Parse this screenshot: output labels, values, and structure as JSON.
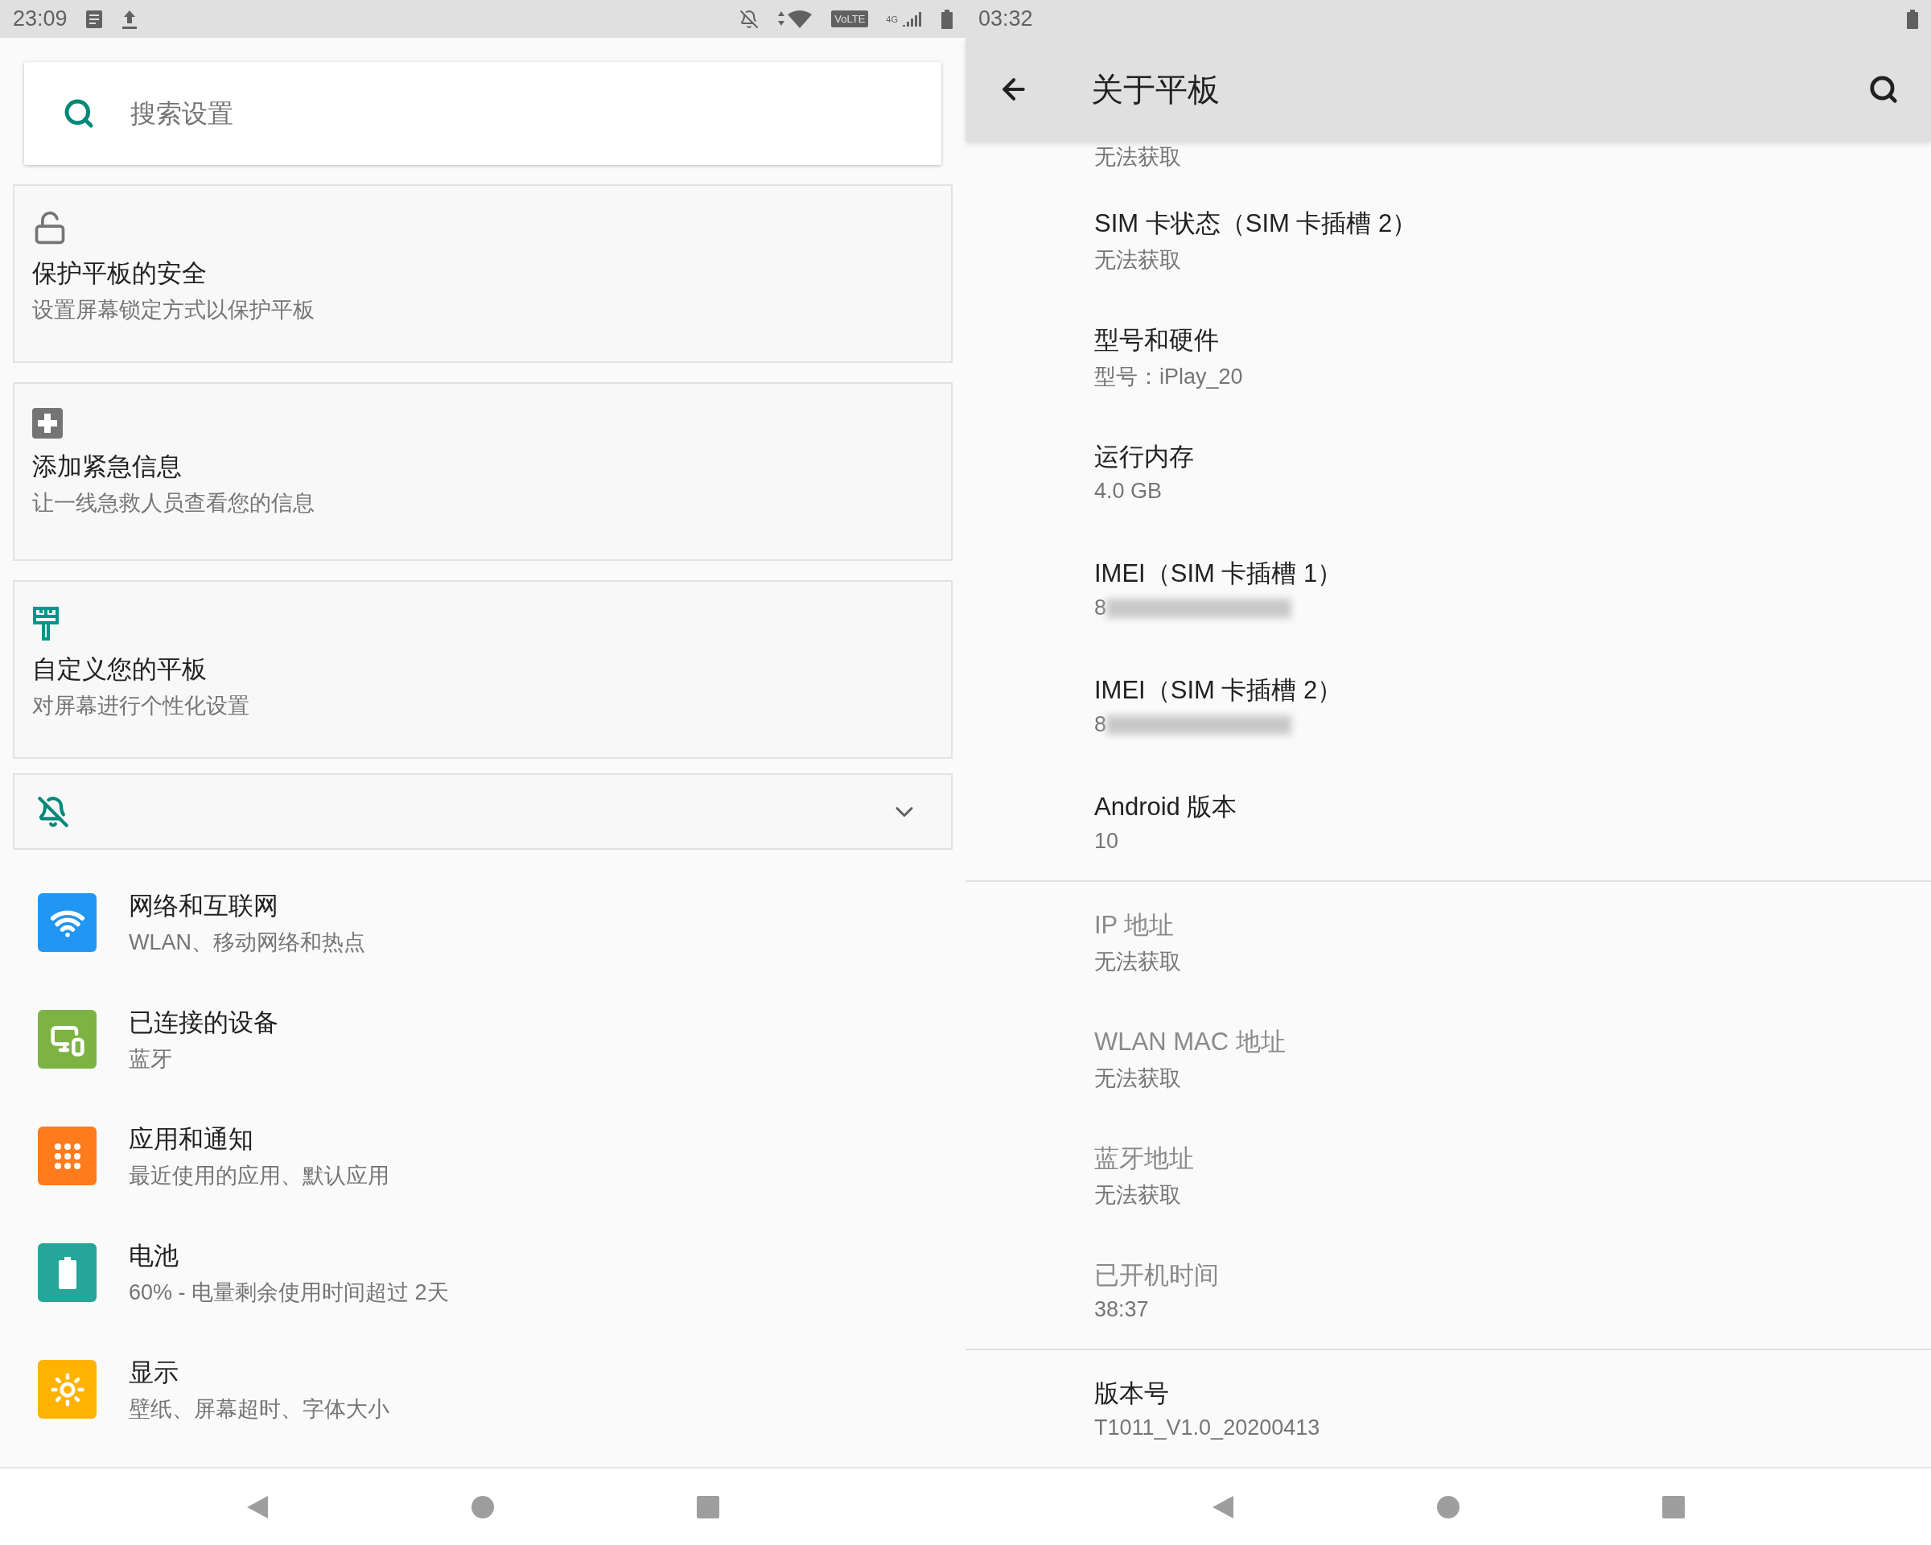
{
  "left_screen": {
    "status_bar": {
      "time": "23:09",
      "volte": "VoLTE",
      "network": "4G"
    },
    "search": {
      "placeholder": "搜索设置"
    },
    "suggestion_cards": [
      {
        "kind": "lock",
        "title": "保护平板的安全",
        "summary": "设置屏幕锁定方式以保护平板"
      },
      {
        "kind": "medical",
        "title": "添加紧急信息",
        "summary": "让一线急救人员查看您的信息"
      },
      {
        "kind": "brush",
        "title": "自定义您的平板",
        "summary": "对屏幕进行个性化设置"
      }
    ],
    "condition_card": {
      "expanded": false
    },
    "settings": [
      {
        "kind": "wifi",
        "color": "#2196f3",
        "title": "网络和互联网",
        "summary": "WLAN、移动网络和热点"
      },
      {
        "kind": "devices",
        "color": "#7cb342",
        "title": "已连接的设备",
        "summary": "蓝牙"
      },
      {
        "kind": "apps",
        "color": "#ff7b1c",
        "title": "应用和通知",
        "summary": "最近使用的应用、默认应用"
      },
      {
        "kind": "battery",
        "color": "#26a69a",
        "title": "电池",
        "summary": "60% - 电量剩余使用时间超过 2天"
      },
      {
        "kind": "display",
        "color": "#ffb300",
        "title": "显示",
        "summary": "壁纸、屏幕超时、字体大小"
      }
    ]
  },
  "right_screen": {
    "status_bar": {
      "time": "03:32"
    },
    "toolbar": {
      "title": "关于平板"
    },
    "partial_summary": "无法获取",
    "groups": [
      [
        {
          "title": "SIM 卡状态（SIM 卡插槽 2）",
          "summary": "无法获取",
          "disabled": false,
          "redacted": false
        },
        {
          "title": "型号和硬件",
          "summary": "型号：iPlay_20",
          "disabled": false,
          "redacted": false
        },
        {
          "title": "运行内存",
          "summary": "4.0 GB",
          "disabled": false,
          "redacted": false
        },
        {
          "title": "IMEI（SIM 卡插槽 1）",
          "summary": "8",
          "disabled": false,
          "redacted": true
        },
        {
          "title": "IMEI（SIM 卡插槽 2）",
          "summary": "8",
          "disabled": false,
          "redacted": true
        },
        {
          "title": "Android 版本",
          "summary": "10",
          "disabled": false,
          "redacted": false
        }
      ],
      [
        {
          "title": "IP 地址",
          "summary": "无法获取",
          "disabled": true,
          "redacted": false
        },
        {
          "title": "WLAN MAC 地址",
          "summary": "无法获取",
          "disabled": true,
          "redacted": false
        },
        {
          "title": "蓝牙地址",
          "summary": "无法获取",
          "disabled": true,
          "redacted": false
        },
        {
          "title": "已开机时间",
          "summary": "38:37",
          "disabled": true,
          "redacted": false
        }
      ],
      [
        {
          "title": "版本号",
          "summary": "T1011_V1.0_20200413",
          "disabled": false,
          "redacted": false
        }
      ]
    ]
  }
}
